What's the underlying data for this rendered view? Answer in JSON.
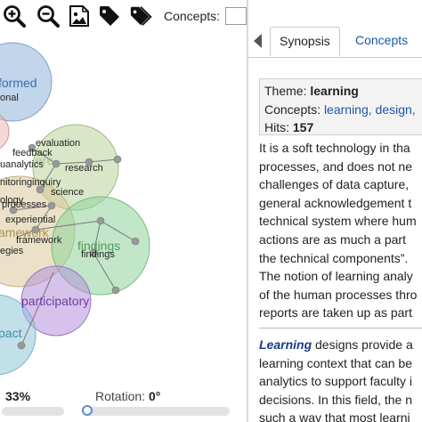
{
  "toolbar": {
    "zoom_in_icon": "zoom-in-icon",
    "zoom_out_icon": "zoom-out-icon",
    "image_icon": "image-icon",
    "tag_icon": "tag-icon",
    "tags_icon": "tags-icon",
    "concepts_label": "Concepts:",
    "concepts_value": ""
  },
  "map": {
    "themes": [
      {
        "label": "formed",
        "color": "#8fb3d9"
      },
      {
        "label": "evaluation",
        "color": "#b9d49a"
      },
      {
        "label": "framework",
        "color": "#d8c89a"
      },
      {
        "label": "findings",
        "color": "#8fd49a"
      },
      {
        "label": "participatory",
        "color": "#b48fd9"
      },
      {
        "label": "pact",
        "color": "#8fc7d9"
      }
    ],
    "concepts": [
      "onal",
      "evaluation",
      "feedback",
      "analytics",
      "research",
      "nitoring",
      "inquiry",
      "science",
      "ology",
      "processes",
      "experiential",
      "framework",
      "egies",
      "findings"
    ]
  },
  "footer": {
    "zoom_value": "33%",
    "rotation_label": "Rotation:",
    "rotation_value": "0°"
  },
  "panel": {
    "tabs": [
      {
        "label": "Synopsis",
        "active": true
      },
      {
        "label": "Concepts",
        "active": false
      }
    ],
    "info": {
      "theme_label": "Theme:",
      "theme_value": "learning",
      "concepts_label": "Concepts:",
      "concepts_value": "learning, design,",
      "hits_label": "Hits:",
      "hits_value": "157"
    },
    "paragraph1": [
      "It is a soft technology in tha",
      "processes, and does not ne",
      "challenges of data capture,",
      "general acknowledgement t",
      "technical system where hum",
      "actions are as much a part",
      "the technical components”.",
      "The notion of learning analy",
      "of the human processes thro",
      "reports are taken up as part"
    ],
    "paragraph2_keyword": "Learning",
    "paragraph2_first_rest": " designs provide a",
    "paragraph2": [
      "learning context that can be",
      "analytics to support faculty i",
      "decisions. In this field, the n",
      "such a way that most learni"
    ]
  }
}
